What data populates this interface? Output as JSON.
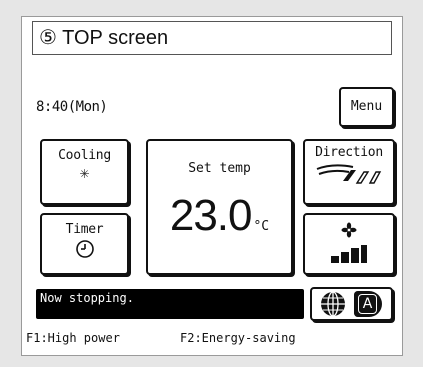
{
  "caption": "⑤ TOP screen",
  "clock": "8:40(Mon)",
  "menu_label": "Menu",
  "mode": {
    "label": "Cooling",
    "icon": "snowflake-icon",
    "glyph": "✳"
  },
  "timer": {
    "label": "Timer",
    "icon": "clock-icon"
  },
  "temperature": {
    "label": "Set temp",
    "value": "23.0",
    "unit": "°C"
  },
  "direction": {
    "label": "Direction",
    "icon": "airflow-direction-icon"
  },
  "fan": {
    "icon": "fan-icon",
    "speed_level_icon": "fan-speed-bars-icon"
  },
  "status": "Now stopping.",
  "language_button": {
    "icons": [
      "globe-icon",
      "letter-a-icon"
    ],
    "letter": "A"
  },
  "function_keys": {
    "f1": "F1:High power",
    "f2": "F2:Energy-saving"
  },
  "colors": {
    "screen": "#ffffff",
    "status_bg": "#000000",
    "ink": "#111111",
    "page": "#e6e6e6"
  }
}
